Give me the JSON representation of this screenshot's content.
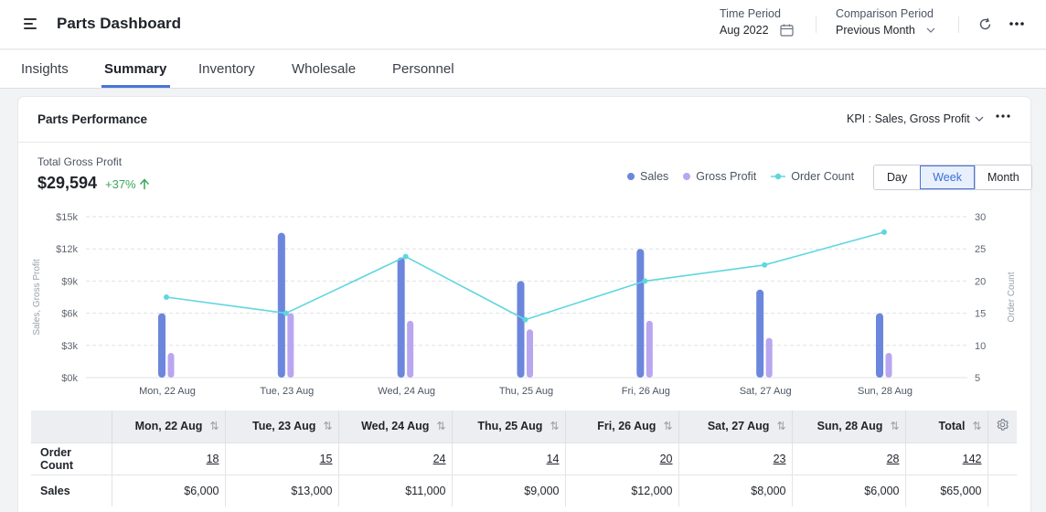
{
  "header": {
    "title": "Parts Dashboard",
    "time_period_label": "Time Period",
    "time_period_value": "Aug 2022",
    "comparison_label": "Comparison Period",
    "comparison_value": "Previous Month"
  },
  "tabs": [
    {
      "label": "Insights"
    },
    {
      "label": "Summary",
      "active": true
    },
    {
      "label": "Inventory"
    },
    {
      "label": "Wholesale"
    },
    {
      "label": "Personnel"
    }
  ],
  "card": {
    "title": "Parts Performance",
    "kpi_label": "KPI : Sales, Gross Profit",
    "gross_profit_label": "Total Gross Profit",
    "gross_profit_value": "$29,594",
    "gross_profit_change": "+37%",
    "legend": {
      "sales": "Sales",
      "gross_profit": "Gross Profit",
      "order_count": "Order Count"
    },
    "granularity": [
      {
        "label": "Day"
      },
      {
        "label": "Week",
        "active": true
      },
      {
        "label": "Month"
      }
    ]
  },
  "colors": {
    "sales": "#6b86dc",
    "gross_profit": "#b9a6f0",
    "order_count": "#5fd6e0",
    "positive": "#3aa757",
    "accent": "#4a74d9"
  },
  "chart_data": {
    "type": "bar",
    "categories": [
      "Mon, 22 Aug",
      "Tue, 23 Aug",
      "Wed, 24 Aug",
      "Thu, 25 Aug",
      "Fri, 26 Aug",
      "Sat, 27 Aug",
      "Sun, 28 Aug"
    ],
    "series": [
      {
        "name": "Sales",
        "values": [
          6000,
          13500,
          11200,
          9000,
          12000,
          8200,
          6000
        ],
        "axis": "left"
      },
      {
        "name": "Gross Profit",
        "values": [
          2300,
          6000,
          5300,
          4500,
          5300,
          3700,
          2300
        ],
        "axis": "left"
      },
      {
        "name": "Order Count",
        "type": "line",
        "values": [
          17.5,
          15,
          23.8,
          14,
          20,
          22.5,
          27.6
        ],
        "axis": "right"
      }
    ],
    "ylabel": "Sales, Gross Profit",
    "y2label": "Order Count",
    "ylim": [
      0,
      15000
    ],
    "y2lim": [
      5,
      30
    ],
    "yticks": [
      "$0k",
      "$3k",
      "$6k",
      "$9k",
      "$12k",
      "$15k"
    ],
    "y2ticks": [
      "5",
      "10",
      "15",
      "20",
      "25",
      "30"
    ],
    "grid": true,
    "legend_position": "top-right"
  },
  "table": {
    "columns": [
      "Mon, 22 Aug",
      "Tue, 23 Aug",
      "Wed, 24 Aug",
      "Thu, 25 Aug",
      "Fri, 26 Aug",
      "Sat, 27 Aug",
      "Sun, 28 Aug"
    ],
    "total_label": "Total",
    "rows": [
      {
        "label": "Order Count",
        "values": [
          "18",
          "15",
          "24",
          "14",
          "20",
          "23",
          "28"
        ],
        "total": "142",
        "underline": true
      },
      {
        "label": "Sales",
        "values": [
          "$6,000",
          "$13,000",
          "$11,000",
          "$9,000",
          "$12,000",
          "$8,000",
          "$6,000"
        ],
        "total": "$65,000",
        "underline": false
      }
    ]
  }
}
